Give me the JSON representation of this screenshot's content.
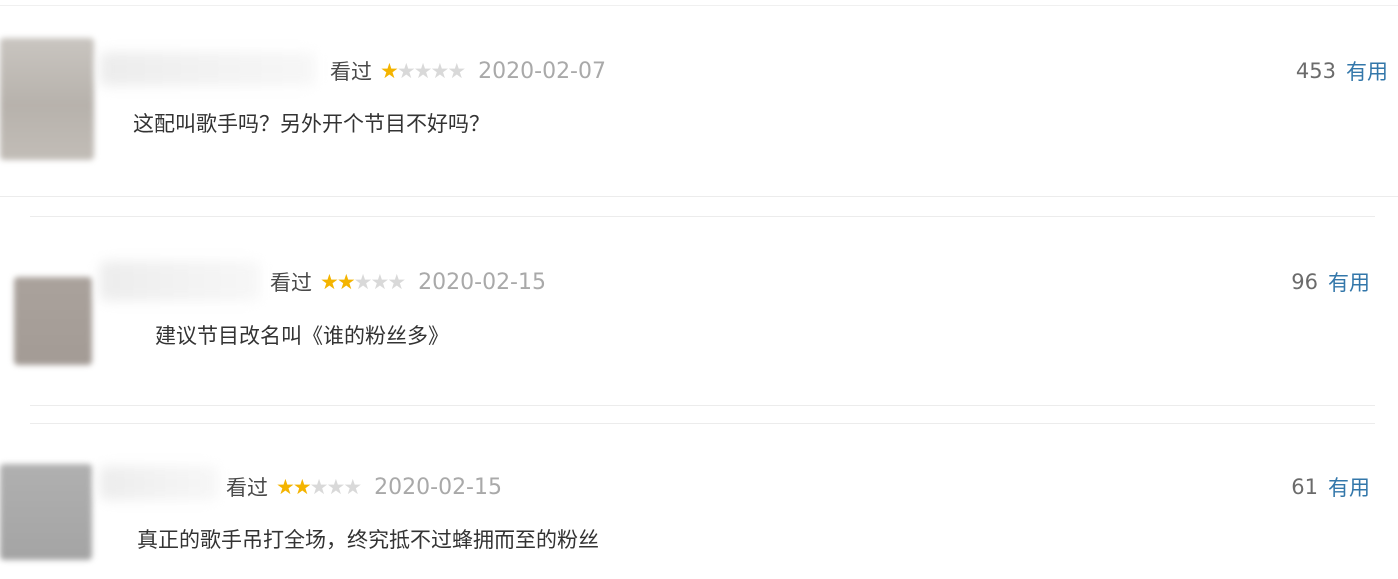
{
  "reviews": [
    {
      "status": "看过",
      "rating": 1,
      "max_rating": 5,
      "date": "2020-02-07",
      "text": "这配叫歌手吗？另外开个节目不好吗？",
      "useful_count": "453",
      "useful_label": "有用"
    },
    {
      "status": "看过",
      "rating": 2,
      "max_rating": 5,
      "date": "2020-02-15",
      "text": "建议节目改名叫《谁的粉丝多》",
      "useful_count": "96",
      "useful_label": "有用"
    },
    {
      "status": "看过",
      "rating": 2,
      "max_rating": 5,
      "date": "2020-02-15",
      "text": "真正的歌手吊打全场，终究抵不过蜂拥而至的粉丝",
      "useful_count": "61",
      "useful_label": "有用"
    }
  ],
  "colors": {
    "star_on": "#f4b400",
    "star_off": "#d9d9d9",
    "useful_link": "#3377aa",
    "date": "#a9a9a9"
  }
}
